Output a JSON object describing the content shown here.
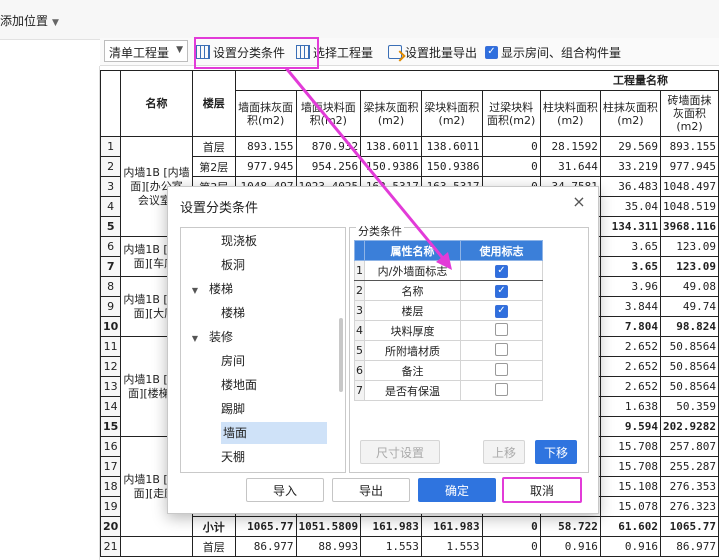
{
  "topbar": {
    "add_position": "添加位置"
  },
  "toolbar": {
    "list_select": "清单工程量",
    "set_classify": "设置分类条件",
    "select_quantity": "选择工程量",
    "batch_export": "设置批量导出",
    "show_room_label": "显示房间、组合构件量",
    "show_room_checked": true
  },
  "table": {
    "header_group": "工程量名称",
    "col_name": "名称",
    "col_floor": "楼层",
    "columns": [
      "墙面抹灰面积(m2)",
      "墙面块料面积(m2)",
      "梁抹灰面积(m2)",
      "梁块料面积(m2)",
      "过梁块料面积(m2)",
      "柱块料面积(m2)",
      "柱抹灰面积(m2)",
      "砖墙面抹灰面积(m2)"
    ],
    "groups": [
      {
        "name": "内墙1B [内墙面][办公室 会议室]"
      },
      {
        "name": "内墙1B [内墙面][车库]"
      },
      {
        "name": "内墙1B [内墙面][大厅]"
      },
      {
        "name": "内墙1B [内墙面][楼梯间]"
      },
      {
        "name": "内墙1B [内墙面][走廊]"
      }
    ],
    "rows": [
      {
        "rn": "1",
        "floor": "首层",
        "v": [
          "893.155",
          "870.932",
          "138.6011",
          "138.6011",
          "0",
          "28.1592",
          "29.569",
          "893.155"
        ]
      },
      {
        "rn": "2",
        "floor": "第2层",
        "v": [
          "977.945",
          "954.256",
          "150.9386",
          "150.9386",
          "0",
          "31.644",
          "33.219",
          "977.945"
        ]
      },
      {
        "rn": "3",
        "floor": "第3层",
        "v": [
          "1048.497",
          "1023.4025",
          "163.5317",
          "163.5317",
          "0",
          "34.7581",
          "36.483",
          "1048.497"
        ]
      },
      {
        "rn": "4",
        "floor": "",
        "v": [
          "",
          "",
          "",
          "",
          "",
          "",
          "35.04",
          "1048.519"
        ]
      },
      {
        "rn": "5",
        "floor": "",
        "v": [
          "",
          "",
          "",
          "",
          "",
          "",
          "134.311",
          "3968.116"
        ],
        "sub": true
      },
      {
        "rn": "6",
        "floor": "",
        "v": [
          "",
          "",
          "",
          "",
          "",
          "",
          "3.65",
          "123.09"
        ]
      },
      {
        "rn": "7",
        "floor": "",
        "v": [
          "",
          "",
          "",
          "",
          "",
          "",
          "3.65",
          "123.09"
        ],
        "sub": true
      },
      {
        "rn": "8",
        "floor": "",
        "v": [
          "",
          "",
          "",
          "",
          "",
          "",
          "3.96",
          "49.08"
        ]
      },
      {
        "rn": "9",
        "floor": "",
        "v": [
          "",
          "",
          "",
          "",
          "",
          "",
          "3.844",
          "49.74"
        ]
      },
      {
        "rn": "10",
        "floor": "",
        "v": [
          "",
          "",
          "",
          "",
          "",
          "",
          "7.804",
          "98.824"
        ],
        "sub": true
      },
      {
        "rn": "11",
        "floor": "",
        "v": [
          "",
          "",
          "",
          "",
          "",
          "",
          "2.652",
          "50.8564"
        ]
      },
      {
        "rn": "12",
        "floor": "",
        "v": [
          "",
          "",
          "",
          "",
          "",
          "",
          "2.652",
          "50.8564"
        ]
      },
      {
        "rn": "13",
        "floor": "",
        "v": [
          "",
          "",
          "",
          "",
          "",
          "",
          "2.652",
          "50.8564"
        ]
      },
      {
        "rn": "14",
        "floor": "",
        "v": [
          "",
          "",
          "",
          "",
          "",
          "",
          "1.638",
          "50.359"
        ]
      },
      {
        "rn": "15",
        "floor": "",
        "v": [
          "",
          "",
          "",
          "",
          "",
          "",
          "9.594",
          "202.9282"
        ],
        "sub": true
      },
      {
        "rn": "16",
        "floor": "",
        "v": [
          "",
          "",
          "",
          "",
          "",
          "",
          "15.708",
          "257.807"
        ]
      },
      {
        "rn": "17",
        "floor": "",
        "v": [
          "",
          "",
          "",
          "",
          "",
          "",
          "15.708",
          "255.287"
        ]
      },
      {
        "rn": "18",
        "floor": "",
        "v": [
          "",
          "",
          "",
          "",
          "",
          "",
          "15.108",
          "276.353"
        ]
      },
      {
        "rn": "19",
        "floor": "",
        "v": [
          "",
          "",
          "",
          "",
          "",
          "",
          "15.078",
          "276.323"
        ]
      },
      {
        "rn": "20",
        "floor": "小计",
        "v": [
          "1065.77",
          "1051.5809",
          "161.983",
          "161.983",
          "0",
          "58.722",
          "61.602",
          "1065.77"
        ],
        "sub": true
      },
      {
        "rn": "21",
        "floor": "首层",
        "v": [
          "86.977",
          "88.993",
          "1.553",
          "1.553",
          "0",
          "0.916",
          "0.916",
          "86.977"
        ]
      }
    ]
  },
  "dialog": {
    "title": "设置分类条件",
    "close": "×",
    "tree": [
      {
        "label": "现浇板",
        "level": 2
      },
      {
        "label": "板洞",
        "level": 2
      },
      {
        "label": "楼梯",
        "level": 1,
        "caret": "▼"
      },
      {
        "label": "楼梯",
        "level": 2
      },
      {
        "label": "装修",
        "level": 1,
        "caret": "▼"
      },
      {
        "label": "房间",
        "level": 2
      },
      {
        "label": "楼地面",
        "level": 2
      },
      {
        "label": "踢脚",
        "level": 2
      },
      {
        "label": "墙面",
        "level": 2,
        "selected": true
      },
      {
        "label": "天棚",
        "level": 2
      }
    ],
    "group_label": "分类条件",
    "attr_header": [
      "属性名称",
      "使用标志"
    ],
    "attrs": [
      {
        "rn": "1",
        "name": "内/外墙面标志",
        "checked": true
      },
      {
        "rn": "2",
        "name": "名称",
        "checked": true
      },
      {
        "rn": "3",
        "name": "楼层",
        "checked": true
      },
      {
        "rn": "4",
        "name": "块料厚度",
        "checked": false
      },
      {
        "rn": "5",
        "name": "所附墙材质",
        "checked": false
      },
      {
        "rn": "6",
        "name": "备注",
        "checked": false
      },
      {
        "rn": "7",
        "name": "是否有保温",
        "checked": false
      }
    ],
    "size_setting": "尺寸设置",
    "move_up": "上移",
    "move_down": "下移",
    "import": "导入",
    "export": "导出",
    "ok": "确定",
    "cancel": "取消"
  }
}
